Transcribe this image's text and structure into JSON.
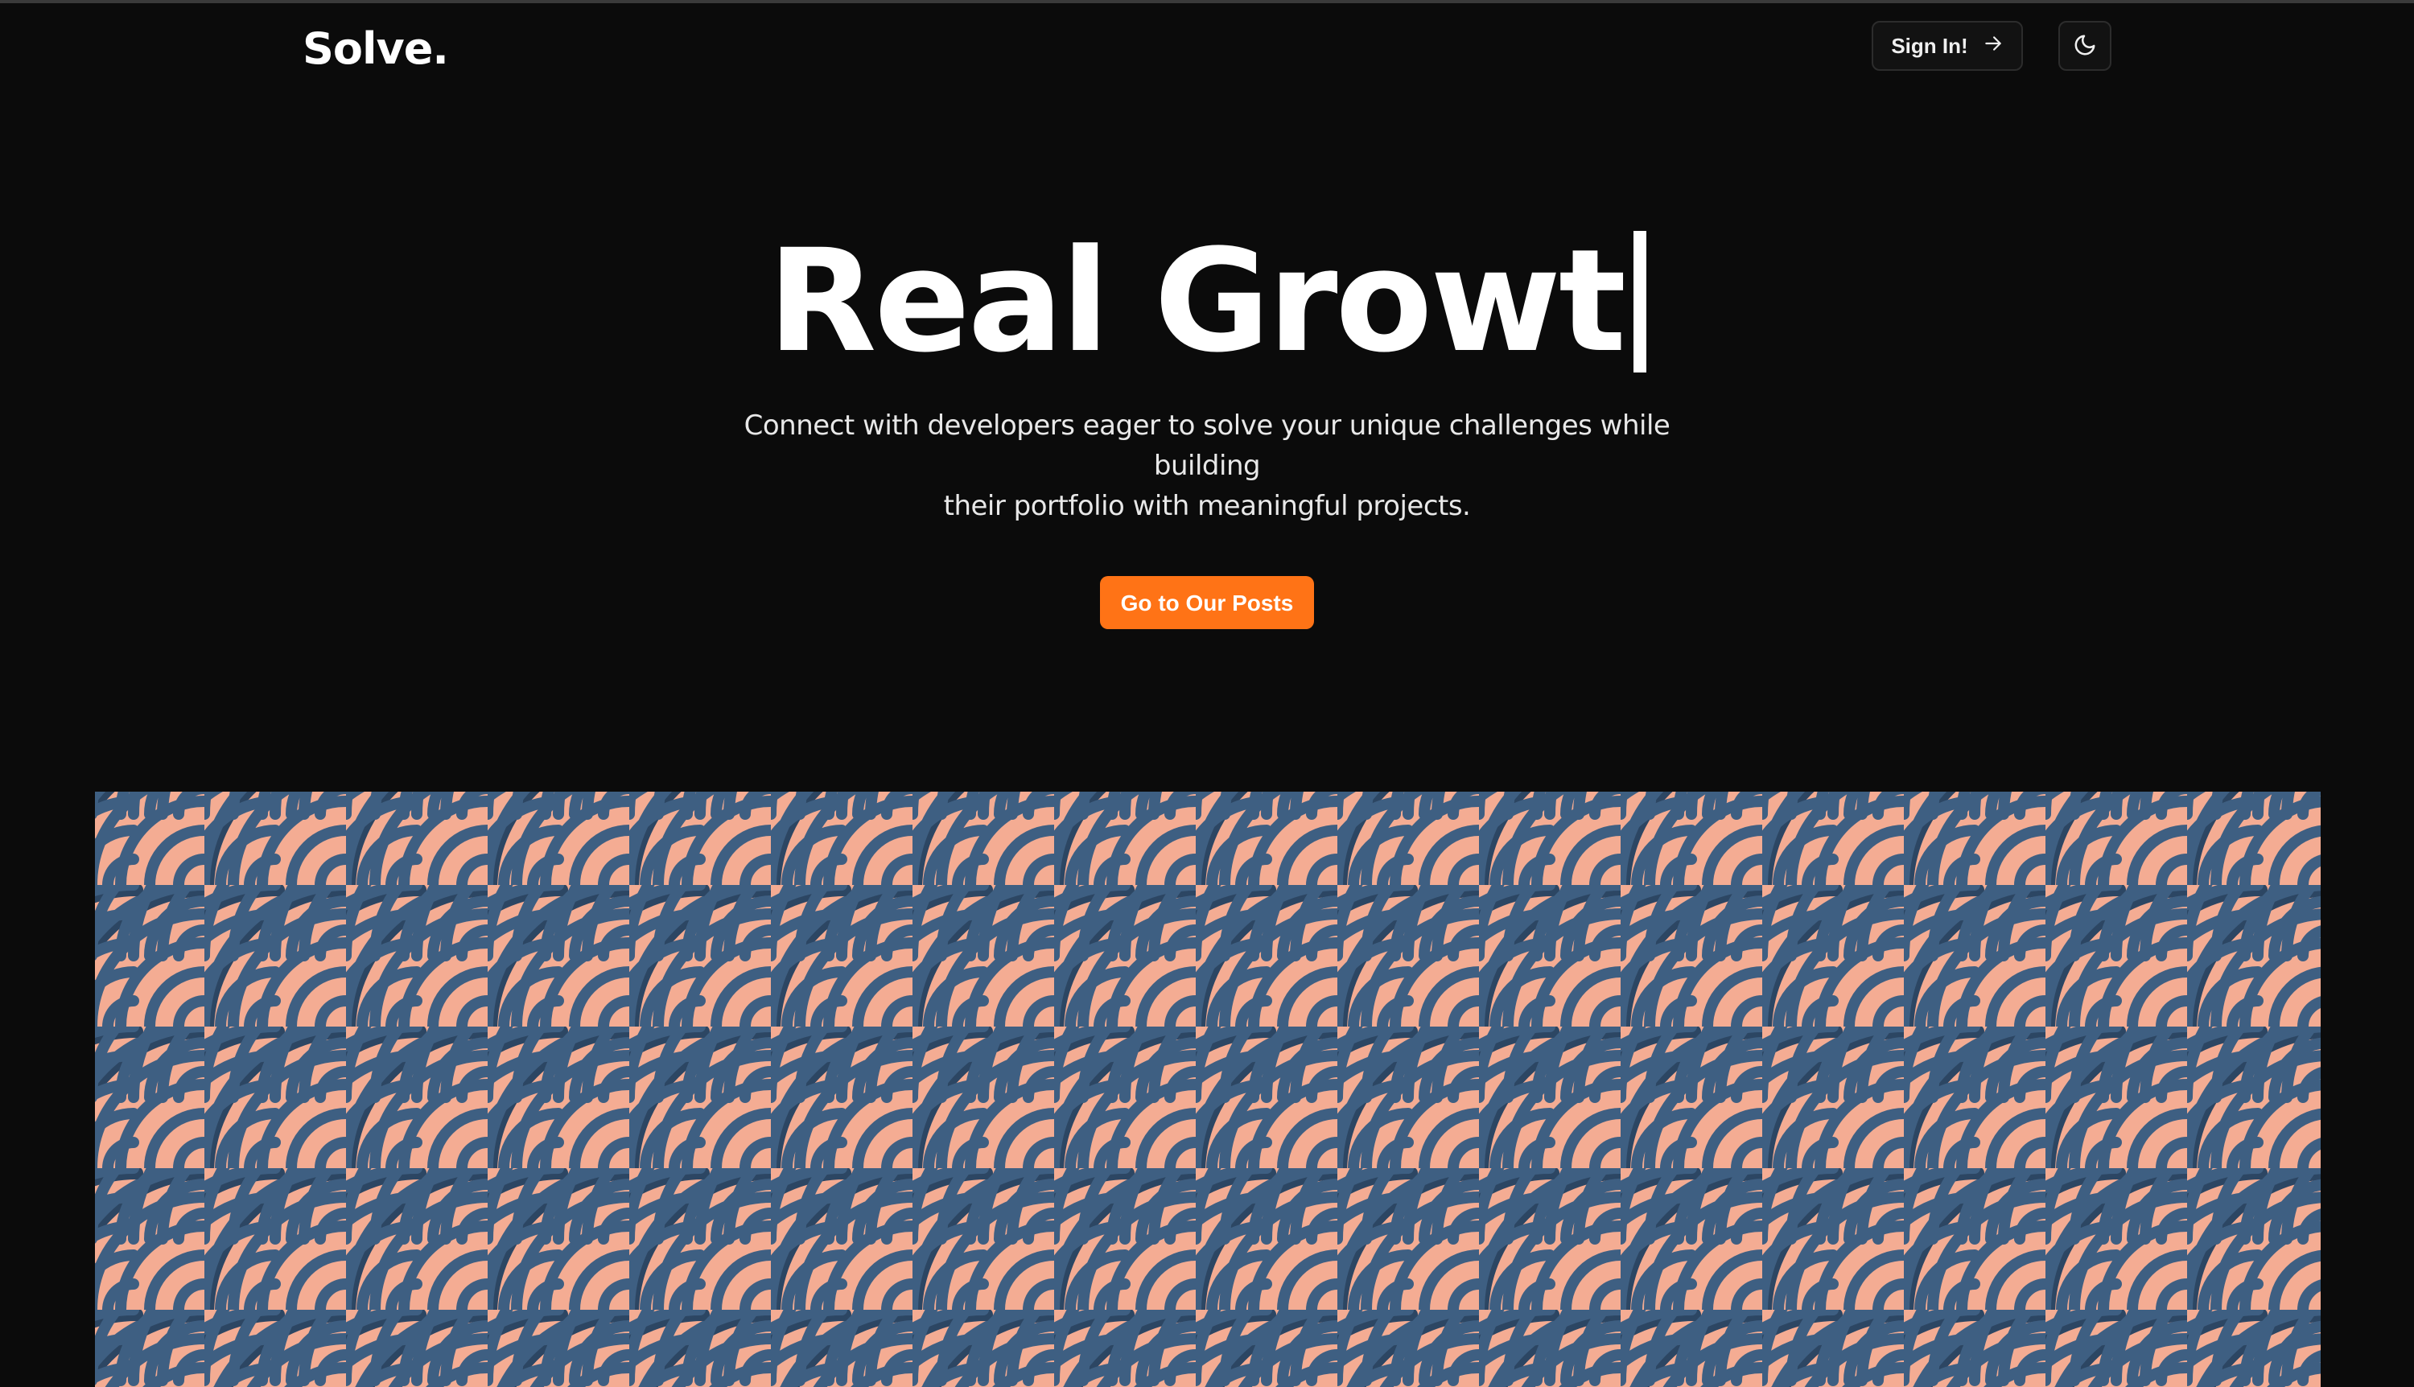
{
  "header": {
    "logo": "Solve.",
    "signin_label": "Sign In!",
    "signin_icon": "arrow-right-icon",
    "theme_icon": "moon-icon"
  },
  "hero": {
    "title": "Real Growt",
    "subtitle_line1": "Connect with developers eager to solve your unique challenges while building",
    "subtitle_line2": "their portfolio with meaningful projects.",
    "cta_label": "Go to Our Posts"
  },
  "colors": {
    "background": "#0b0b0b",
    "accent": "#ff7316",
    "pattern_blue": "#3e5f82",
    "pattern_peach": "#f4ac93"
  }
}
